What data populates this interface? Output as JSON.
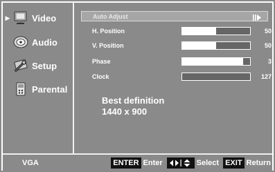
{
  "menu": {
    "items": [
      {
        "label": "Video",
        "icon": "monitor-icon",
        "selected": true
      },
      {
        "label": "Audio",
        "icon": "speaker-icon",
        "selected": false
      },
      {
        "label": "Setup",
        "icon": "settings-icon",
        "selected": false
      },
      {
        "label": "Parental",
        "icon": "parental-control-icon",
        "selected": false
      }
    ]
  },
  "main": {
    "auto_adjust": {
      "label": "Auto Adjust",
      "icon": "play-forward-icon"
    },
    "params": [
      {
        "label": "H. Position",
        "value": "50",
        "level": 0.5
      },
      {
        "label": "V. Position",
        "value": "50",
        "level": 0.5
      },
      {
        "label": "Phase",
        "value": "3",
        "level": 0.1
      },
      {
        "label": "Clock",
        "value": "127",
        "level": 1.0
      }
    ],
    "resolution": {
      "title": "Best definition",
      "value": "1440 x 900"
    }
  },
  "footer": {
    "source": "VGA",
    "hints": [
      {
        "key": "ENTER",
        "text": "Enter"
      },
      {
        "key_icon": "left-right-up-down-arrows-icon",
        "text": "Select"
      },
      {
        "key": "EXIT",
        "text": "Return"
      }
    ]
  },
  "colors": {
    "background": "#8a8a8a",
    "text": "#ffffff",
    "bar_track": "#ffffff",
    "bar_fill": "#666666",
    "key_background": "#111111"
  }
}
